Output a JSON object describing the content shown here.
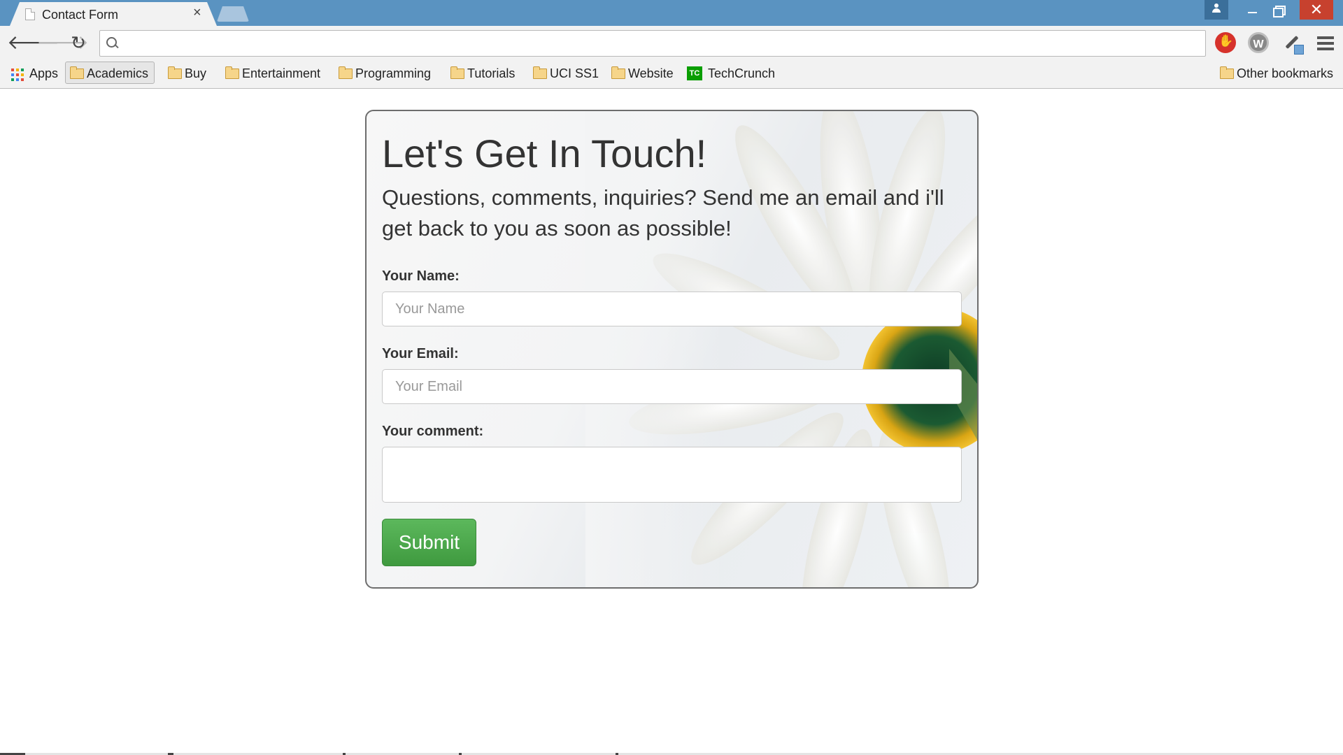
{
  "browser": {
    "tab_title": "Contact Form",
    "tab_close": "×",
    "address_value": "",
    "window_close": "✕"
  },
  "toolbar": {
    "back_icon": "🡐",
    "forward_icon": "🡒",
    "reload_icon": "↻",
    "ext_w_label": "W"
  },
  "bookmarks": {
    "apps": "Apps",
    "items": [
      "Academics",
      "Buy",
      "Entertainment",
      "Programming",
      "Tutorials",
      "UCI SS1",
      "Website",
      "TechCrunch"
    ],
    "techcrunch_icon": "TC",
    "other": "Other bookmarks"
  },
  "form": {
    "title": "Let's Get In Touch!",
    "subtitle": "Questions, comments, inquiries? Send me an email and i'll get back to you as soon as possible!",
    "name_label": "Your Name:",
    "name_placeholder": "Your Name",
    "email_label": "Your Email:",
    "email_placeholder": "Your Email",
    "comment_label": "Your comment:",
    "submit_label": "Submit"
  },
  "colors": {
    "titlebar": "#5a93c1",
    "submit": "#4cae4c",
    "close": "#c7412e"
  }
}
